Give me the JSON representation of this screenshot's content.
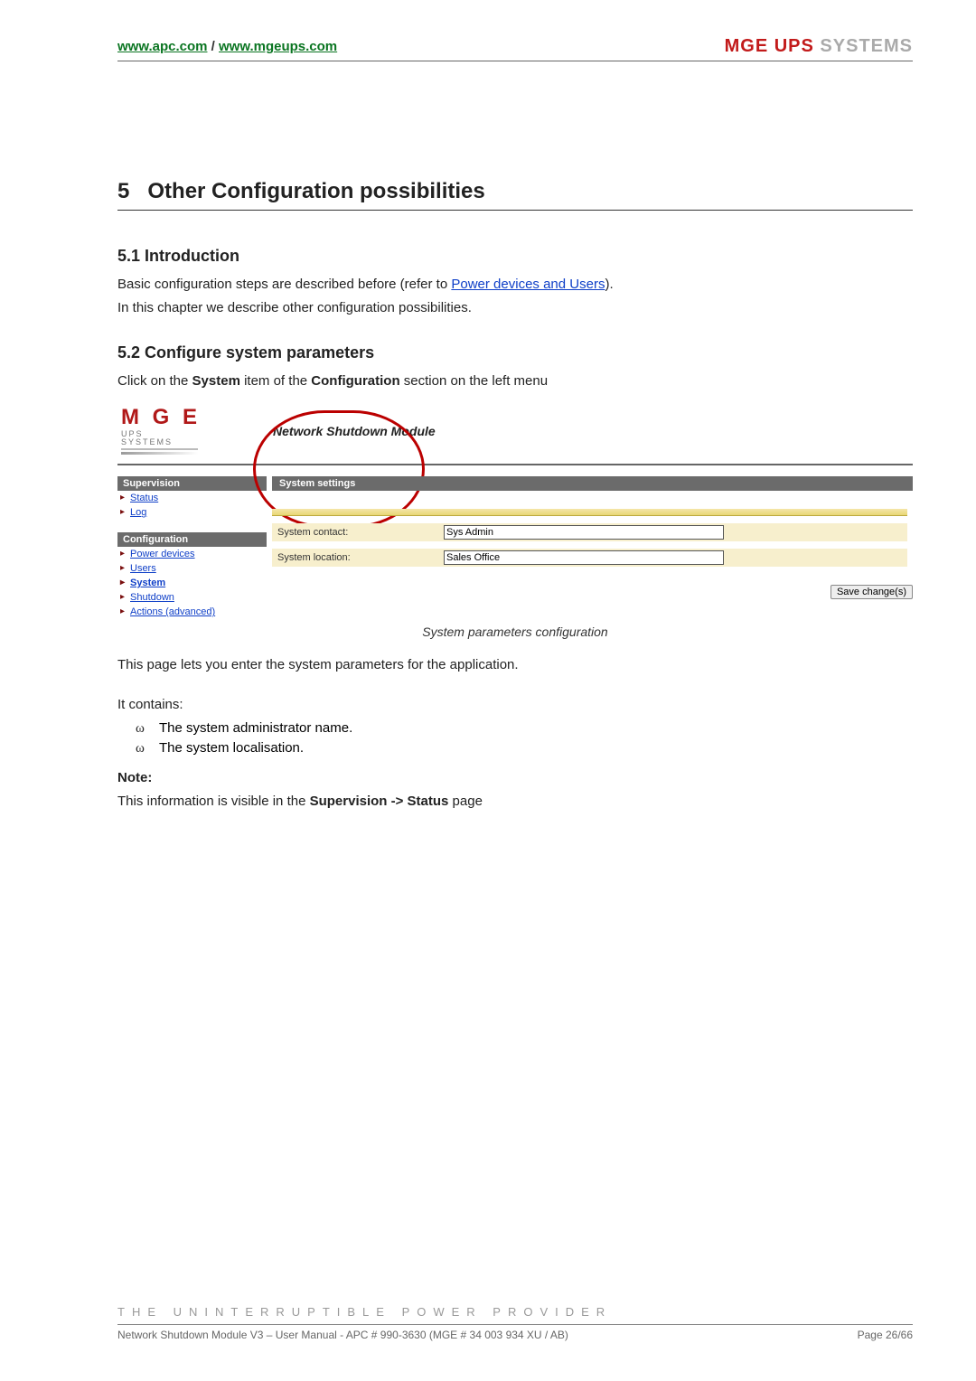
{
  "header": {
    "link1": "www.apc.com",
    "sep": " / ",
    "link2": "www.mgeups.com",
    "logo_mge": "MGE ",
    "logo_ups": "UPS ",
    "logo_sys": "SYSTEMS"
  },
  "chapter": {
    "number": "5",
    "title": "Other Configuration possibilities"
  },
  "sec1": {
    "heading": "5.1   Introduction",
    "p1a": "Basic configuration steps are described before (refer to ",
    "p1link": "Power devices and Users",
    "p1b": ").",
    "p2": "In this chapter we describe other configuration possibilities."
  },
  "sec2": {
    "heading": "5.2   Configure system parameters",
    "p1a": "Click on the ",
    "p1b": "System",
    "p1c": " item of the ",
    "p1d": "Configuration",
    "p1e": " section on the left menu"
  },
  "ui": {
    "logo_big": "M G E",
    "logo_small": "UPS SYSTEMS",
    "title": "Network Shutdown Module",
    "side": {
      "supervision": "Supervision",
      "status": "Status",
      "log": "Log",
      "configuration": "Configuration",
      "power": "Power devices",
      "users": "Users",
      "system": "System",
      "shutdown": "Shutdown",
      "actions": "Actions (advanced)"
    },
    "panel": {
      "title": "System settings",
      "label_contact": "System contact:",
      "value_contact": "Sys Admin",
      "label_location": "System location:",
      "value_location": "Sales Office",
      "save": "Save change(s)"
    },
    "caption": "System parameters configuration"
  },
  "after": {
    "p1": "This page lets you enter the system parameters for the application.",
    "p2": "It contains:",
    "li1": "The system administrator name.",
    "li2": "The system localisation.",
    "note_label": "Note:",
    "note_a": "This information is visible in the ",
    "note_b": "Supervision -> Status",
    "note_c": " page"
  },
  "footer": {
    "tagline": "THE UNINTERRUPTIBLE POWER PROVIDER",
    "left": "Network Shutdown Module V3 – User Manual - APC # 990-3630 (MGE # 34 003 934 XU / AB)",
    "right": "Page 26/66"
  }
}
